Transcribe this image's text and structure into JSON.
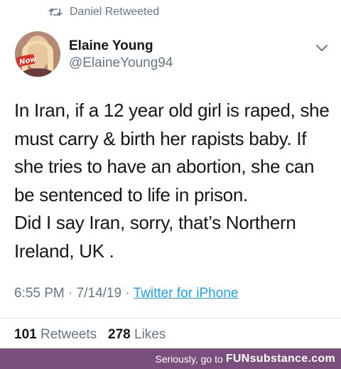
{
  "retweet_banner": {
    "icon": "retweet-icon",
    "text": "Daniel Retweeted"
  },
  "author": {
    "display_name": "Elaine Young",
    "handle": "@ElaineYoung94",
    "avatar_badge": "Now"
  },
  "menu_icon": "chevron-down-icon",
  "tweet": {
    "lines": [
      "In Iran, if a 12 year old girl is raped, she",
      "must carry & birth her rapists baby. If",
      "she tries to have an abortion, she can",
      "be sentenced to life in prison.",
      "Did I say Iran, sorry, that’s Northern",
      "Ireland, UK ."
    ]
  },
  "meta": {
    "time": "6:55 PM",
    "separator": "·",
    "date": "7/14/19",
    "source": "Twitter for iPhone"
  },
  "stats": {
    "retweets_count": "101",
    "retweets_label": "Retweets",
    "likes_count": "278",
    "likes_label": "Likes"
  },
  "watermark": {
    "prefix": "Seriously, go to",
    "brand": "FUNsubstance.com"
  },
  "colors": {
    "primary_text": "#14171a",
    "secondary_text": "#657786",
    "link": "#1da1f2",
    "footer_bg": "#7a4f7e"
  }
}
